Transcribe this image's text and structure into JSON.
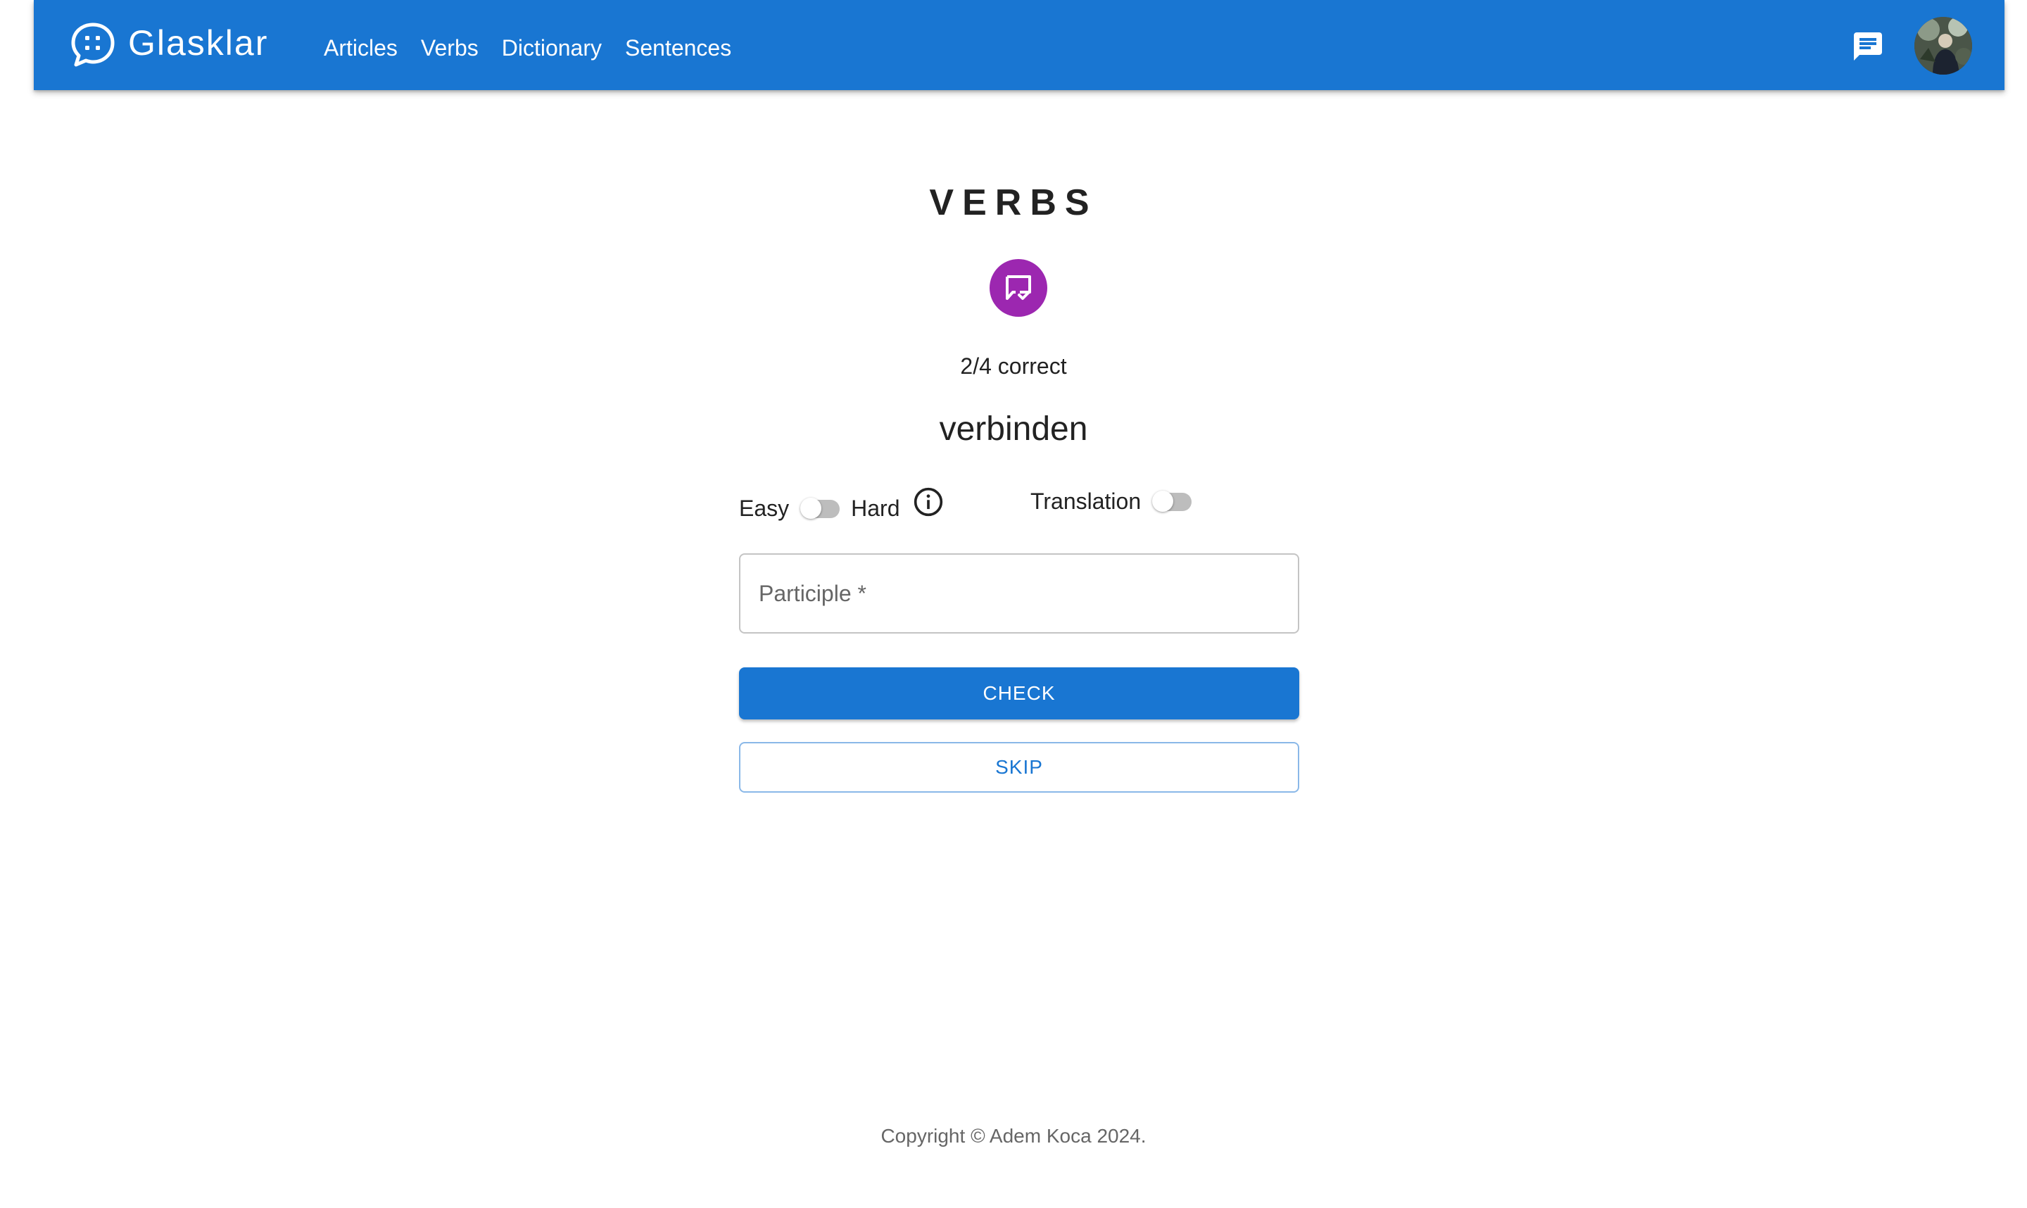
{
  "header": {
    "brand": "Glasklar",
    "nav": [
      "Articles",
      "Verbs",
      "Dictionary",
      "Sentences"
    ],
    "icons": {
      "logo": "chat-bubble-dots-icon",
      "messages": "message-icon",
      "avatar": "user-avatar"
    }
  },
  "quiz": {
    "title": "VERBS",
    "badge_icon": "message-check-icon",
    "score": "2/4 correct",
    "word": "verbinden",
    "difficulty": {
      "left_label": "Easy",
      "right_label": "Hard",
      "on": false,
      "info_icon": "info-icon"
    },
    "translation": {
      "label": "Translation",
      "on": false
    },
    "participle_field": {
      "placeholder": "Participle *",
      "value": ""
    },
    "check_label": "CHECK",
    "skip_label": "SKIP"
  },
  "footer": {
    "copyright": "Copyright © Adem Koca 2024."
  },
  "colors": {
    "primary": "#1976d2",
    "badge": "#9c27b0"
  }
}
